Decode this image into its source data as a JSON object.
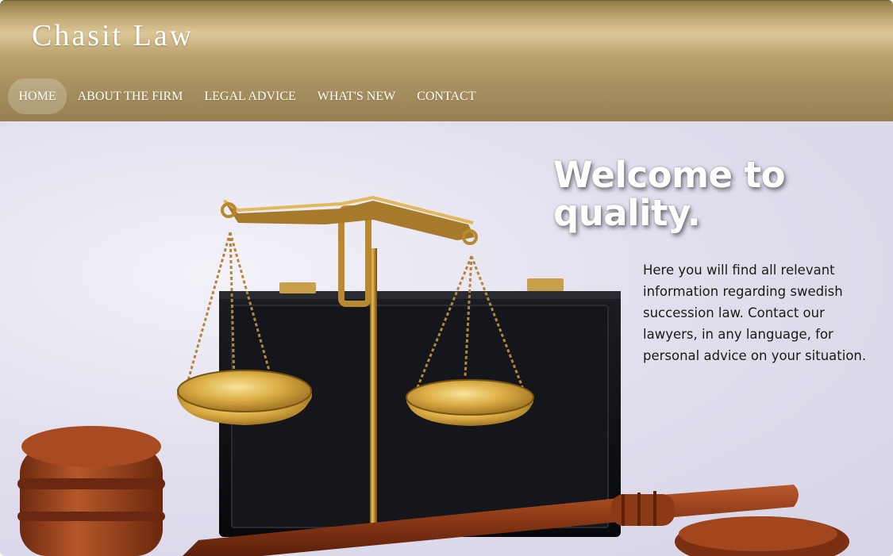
{
  "header": {
    "brand": "Chasit Law",
    "nav": [
      {
        "label": "HOME",
        "active": true
      },
      {
        "label": "ABOUT THE FIRM",
        "active": false
      },
      {
        "label": "LEGAL ADVICE",
        "active": false
      },
      {
        "label": "WHAT'S NEW",
        "active": false
      },
      {
        "label": "CONTACT",
        "active": false
      }
    ]
  },
  "hero": {
    "title": "Welcome to quality.",
    "text": "Here you will find all relevant information regarding swedish succession law. Contact our lawyers, in any language, for personal advice on your situation.",
    "image": "scales-of-justice-gavel-photo"
  },
  "colors": {
    "header_gold": "#bba270",
    "header_dark": "#97804f",
    "nav_text": "#ffffff",
    "hero_bg": "#e2e0ee",
    "body_text": "#1d1a14"
  }
}
